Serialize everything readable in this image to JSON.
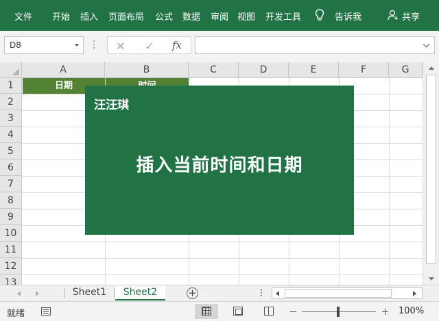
{
  "ribbon": {
    "tabs": [
      {
        "label": "文件"
      },
      {
        "label": "开始"
      },
      {
        "label": "插入"
      },
      {
        "label": "页面布局"
      },
      {
        "label": "公式"
      },
      {
        "label": "数据"
      },
      {
        "label": "审阅"
      },
      {
        "label": "视图"
      },
      {
        "label": "开发工具"
      }
    ],
    "tell_me": "告诉我",
    "share": "共享",
    "bg_color": "#217346"
  },
  "formula_bar": {
    "name_box": "D8",
    "formula": ""
  },
  "sheet": {
    "columns": [
      "A",
      "B",
      "C",
      "D",
      "E",
      "F",
      "G"
    ],
    "rows": [
      "1",
      "2",
      "3",
      "4",
      "5",
      "6",
      "7",
      "8",
      "9",
      "10",
      "11",
      "12",
      "13"
    ],
    "header_cells": {
      "A1": "日期",
      "B1": "时间"
    },
    "header_fill": "#548235"
  },
  "banner": {
    "author": "汪汪琪",
    "headline": "插入当前时间和日期",
    "bg_color": "#217346"
  },
  "sheet_tabs": [
    {
      "label": "Sheet1",
      "active": false
    },
    {
      "label": "Sheet2",
      "active": true
    }
  ],
  "status": {
    "ready": "就绪",
    "zoom": "100%"
  }
}
